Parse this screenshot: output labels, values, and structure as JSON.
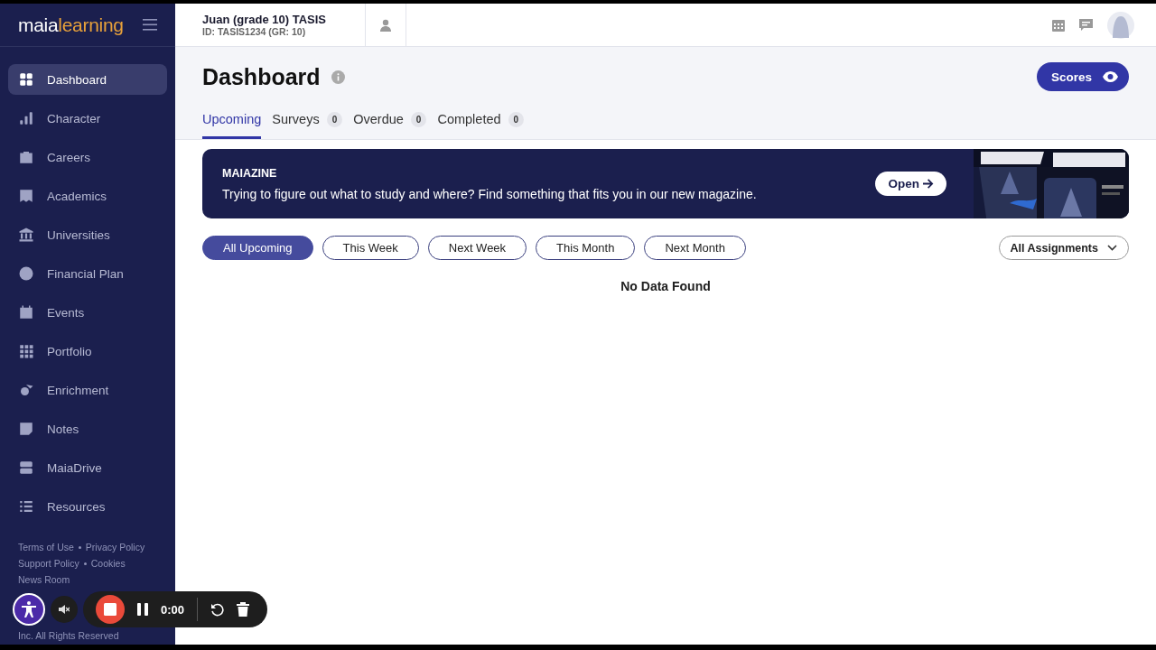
{
  "sidebar": {
    "logo": {
      "part1": "maia",
      "part2": "learning"
    },
    "items": [
      {
        "label": "Dashboard",
        "selected": true
      },
      {
        "label": "Character",
        "selected": false
      },
      {
        "label": "Careers",
        "selected": false
      },
      {
        "label": "Academics",
        "selected": false
      },
      {
        "label": "Universities",
        "selected": false
      },
      {
        "label": "Financial Plan",
        "selected": false
      },
      {
        "label": "Events",
        "selected": false
      },
      {
        "label": "Portfolio",
        "selected": false
      },
      {
        "label": "Enrichment",
        "selected": false
      },
      {
        "label": "Notes",
        "selected": false
      },
      {
        "label": "MaiaDrive",
        "selected": false
      },
      {
        "label": "Resources",
        "selected": false
      }
    ],
    "footer_lines": [
      [
        "Terms of Use",
        "Privacy Policy"
      ],
      [
        "Support Policy",
        "Cookies"
      ],
      [
        "News Room"
      ],
      [
        "Inc. All Rights Reserved"
      ]
    ]
  },
  "topbar": {
    "student_name": "Juan (grade 10) TASIS",
    "student_id": "ID: TASIS1234 (GR: 10)"
  },
  "page": {
    "title": "Dashboard",
    "scores_button": "Scores",
    "tabs": [
      {
        "label": "Upcoming",
        "selected": true
      },
      {
        "label": "Surveys",
        "count": "0",
        "selected": false
      },
      {
        "label": "Overdue",
        "count": "0",
        "selected": false
      },
      {
        "label": "Completed",
        "count": "0",
        "selected": false
      }
    ],
    "banner": {
      "title": "MAIAZINE",
      "text": "Trying to figure out what to study and where? Find something that fits you in our new magazine.",
      "button": "Open"
    },
    "filters": [
      {
        "label": "All Upcoming",
        "selected": true
      },
      {
        "label": "This Week",
        "selected": false
      },
      {
        "label": "Next Week",
        "selected": false
      },
      {
        "label": "This Month",
        "selected": false
      },
      {
        "label": "Next Month",
        "selected": false
      }
    ],
    "assignment_filter": "All Assignments",
    "empty_message": "No Data Found"
  },
  "recorder": {
    "time": "0:00"
  }
}
